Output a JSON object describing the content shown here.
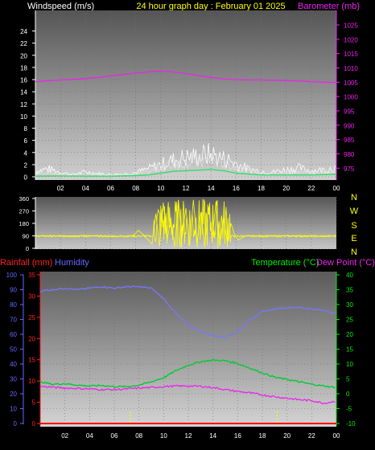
{
  "header": {
    "wind_label": "Windspeed (m/s)",
    "title": "24 hour graph day : February 01 2025",
    "baro_label": "Barometer (mb)"
  },
  "colors": {
    "wind": "#e0e0e0",
    "gust": "#ffffff",
    "wind_avg": "#33dd66",
    "barometer": "#ee22ee",
    "direction": "#ffff00",
    "humidity": "#7777ff",
    "temperature": "#00cc33",
    "dewpoint": "#ee22ee",
    "rainfall": "#ff0000",
    "temp_axis": "#00ee00",
    "rain_axis": "#ff2222",
    "hum_axis": "#6666ff"
  },
  "x_ticks": [
    "02",
    "04",
    "06",
    "08",
    "10",
    "12",
    "14",
    "16",
    "18",
    "20",
    "22",
    "00"
  ],
  "compass": [
    "N",
    "W",
    "S",
    "E",
    "N"
  ],
  "bottom_labels": {
    "rainfall": "Rainfall (mm)",
    "humidity": "Humidity",
    "temperature": "Temperature (°C)",
    "dewpoint": "Dew Point (°C)"
  },
  "chart_data": [
    {
      "type": "line",
      "panel": "wind-barometer",
      "x_range": [
        0,
        24
      ],
      "y_left": {
        "label": "Windspeed (m/s)",
        "range": [
          0,
          25
        ],
        "ticks": [
          "0",
          "2",
          "4",
          "6",
          "8",
          "10",
          "12",
          "14",
          "16",
          "18",
          "20",
          "22",
          "24"
        ]
      },
      "y_right": {
        "label": "Barometer (mb)",
        "range": [
          972,
          1025
        ],
        "ticks": [
          "975",
          "980",
          "985",
          "990",
          "995",
          "1000",
          "1005",
          "1010",
          "1015",
          "1020",
          "1025"
        ]
      },
      "series": [
        {
          "name": "Windspeed",
          "axis": "left",
          "x": [
            0,
            1,
            2,
            3,
            4,
            5,
            6,
            7,
            8,
            9,
            9.5,
            10,
            10.5,
            11,
            11.5,
            12,
            12.5,
            13,
            13.5,
            14,
            14.5,
            15,
            15.5,
            16,
            17,
            18,
            19,
            20,
            21,
            22,
            23,
            24
          ],
          "y": [
            0.5,
            0.8,
            0.3,
            0.2,
            0.4,
            0.3,
            0.2,
            0.3,
            0.4,
            0.8,
            1.3,
            1.5,
            1.9,
            2.1,
            2.3,
            2.5,
            2.6,
            2.7,
            2.8,
            2.9,
            2.6,
            2.3,
            2.1,
            1.6,
            0.9,
            0.6,
            0.5,
            0.7,
            0.9,
            0.6,
            0.7,
            0.9
          ]
        },
        {
          "name": "Gust",
          "axis": "left",
          "x": [
            0,
            1,
            2,
            3,
            4,
            5,
            6,
            7,
            8,
            9,
            9.5,
            10,
            10.5,
            11,
            11.5,
            12,
            12.5,
            13,
            13.5,
            14,
            14.5,
            15,
            15.5,
            16,
            17,
            18,
            19,
            20,
            21,
            22,
            23,
            24
          ],
          "y": [
            1.0,
            1.5,
            0.8,
            0.4,
            0.9,
            0.6,
            0.4,
            0.5,
            0.8,
            1.4,
            1.9,
            2.2,
            2.7,
            3.0,
            3.3,
            3.5,
            3.6,
            3.8,
            4.0,
            4.1,
            3.7,
            3.3,
            3.0,
            2.4,
            1.4,
            1.0,
            0.9,
            1.3,
            1.6,
            1.1,
            1.3,
            1.8
          ]
        },
        {
          "name": "Average",
          "axis": "left",
          "x": [
            0,
            2,
            4,
            6,
            8,
            9,
            10,
            11,
            12,
            13,
            14,
            15,
            16,
            18,
            20,
            22,
            24
          ],
          "y": [
            0.1,
            0.15,
            0.1,
            0.1,
            0.2,
            0.3,
            0.6,
            0.9,
            1.0,
            1.1,
            1.2,
            1.0,
            0.6,
            0.3,
            0.3,
            0.3,
            0.4
          ]
        },
        {
          "name": "Barometer",
          "axis": "right",
          "x": [
            0,
            1,
            2,
            3,
            4,
            5,
            6,
            7,
            8,
            9,
            10,
            11,
            12,
            13,
            14,
            15,
            16,
            17,
            18,
            19,
            20,
            21,
            22,
            23,
            24
          ],
          "y": [
            1005.2,
            1005.5,
            1005.8,
            1006.0,
            1006.3,
            1006.7,
            1007.2,
            1007.7,
            1008.2,
            1008.6,
            1008.9,
            1008.6,
            1008.0,
            1007.3,
            1006.7,
            1006.2,
            1005.9,
            1005.8,
            1005.8,
            1005.7,
            1005.6,
            1005.4,
            1005.2,
            1005.0,
            1004.9
          ]
        }
      ]
    },
    {
      "type": "line",
      "panel": "wind-direction",
      "x_range": [
        0,
        24
      ],
      "y_range": [
        0,
        360
      ],
      "y_ticks": [
        "0",
        "90",
        "180",
        "270",
        "360"
      ],
      "series": [
        {
          "name": "Wind direction",
          "x": [
            0,
            2,
            4,
            6,
            7.8,
            8.2,
            8.6,
            9.0,
            9.3,
            9.6,
            9.9,
            10.2,
            10.5,
            10.8,
            11.1,
            11.4,
            11.7,
            12.0,
            12.3,
            12.6,
            12.9,
            13.2,
            13.5,
            13.8,
            14.1,
            14.4,
            14.7,
            15.0,
            15.3,
            15.6,
            15.9,
            16.2,
            16.6,
            17,
            19,
            21,
            23,
            24
          ],
          "y": [
            90,
            88,
            92,
            85,
            90,
            130,
            100,
            60,
            30,
            250,
            15,
            330,
            60,
            200,
            10,
            345,
            80,
            290,
            20,
            350,
            45,
            260,
            10,
            300,
            70,
            340,
            15,
            220,
            40,
            180,
            90,
            60,
            85,
            90,
            88,
            92,
            85,
            90
          ]
        }
      ]
    },
    {
      "type": "line",
      "panel": "temperature-humidity",
      "x_range": [
        0,
        24
      ],
      "y_left_rain": {
        "label": "Rainfall (mm)",
        "range": [
          0,
          35
        ],
        "ticks": [
          "0",
          "5",
          "10",
          "15",
          "20",
          "25",
          "30",
          "35"
        ]
      },
      "y_left_humidity": {
        "label": "Humidity",
        "range": [
          0,
          100
        ],
        "ticks": [
          "0",
          "10",
          "20",
          "30",
          "40",
          "50",
          "60",
          "70",
          "80",
          "90",
          "100"
        ]
      },
      "y_right_temp": {
        "label": "Temperature (°C)",
        "range": [
          -10,
          40
        ],
        "ticks": [
          "-10",
          "-5",
          "0",
          "5",
          "10",
          "15",
          "20",
          "25",
          "30",
          "35",
          "40"
        ]
      },
      "series": [
        {
          "name": "Humidity",
          "axis": "humidity",
          "x": [
            0,
            1,
            2,
            3,
            4,
            5,
            6,
            7,
            8,
            9,
            10,
            11,
            12,
            13,
            14,
            15,
            16,
            17,
            18,
            19,
            20,
            21,
            22,
            23,
            24
          ],
          "y": [
            89,
            90,
            91,
            90,
            91,
            92,
            91,
            92,
            92,
            91,
            84,
            74,
            66,
            62,
            59,
            58,
            62,
            70,
            75,
            77,
            78,
            78,
            77,
            76,
            74
          ]
        },
        {
          "name": "Temperature",
          "axis": "temp",
          "x": [
            0,
            1,
            2,
            3,
            4,
            5,
            6,
            7,
            8,
            9,
            10,
            11,
            12,
            13,
            14,
            15,
            16,
            17,
            18,
            19,
            20,
            21,
            22,
            23,
            24
          ],
          "y": [
            4.0,
            3.2,
            3.4,
            2.9,
            2.6,
            2.8,
            2.4,
            2.4,
            2.9,
            4.0,
            5.4,
            7.8,
            9.6,
            10.8,
            11.3,
            11.1,
            10.2,
            8.6,
            7.0,
            5.6,
            4.8,
            4.0,
            3.2,
            2.6,
            2.1
          ]
        },
        {
          "name": "Dew Point",
          "axis": "temp",
          "x": [
            0,
            1,
            2,
            3,
            4,
            5,
            6,
            7,
            8,
            9,
            10,
            11,
            12,
            13,
            14,
            15,
            16,
            17,
            18,
            19,
            20,
            21,
            22,
            23,
            24
          ],
          "y": [
            2.5,
            2.2,
            1.9,
            1.8,
            1.6,
            1.4,
            1.4,
            1.6,
            1.9,
            2.1,
            2.4,
            2.6,
            2.6,
            2.5,
            2.1,
            1.4,
            0.8,
            0.3,
            -0.4,
            -1.0,
            -1.5,
            -2.0,
            -2.3,
            -3.2,
            -2.4
          ]
        },
        {
          "name": "Rainfall",
          "axis": "rain",
          "x": [
            0,
            24
          ],
          "y": [
            0,
            0
          ]
        }
      ]
    }
  ]
}
